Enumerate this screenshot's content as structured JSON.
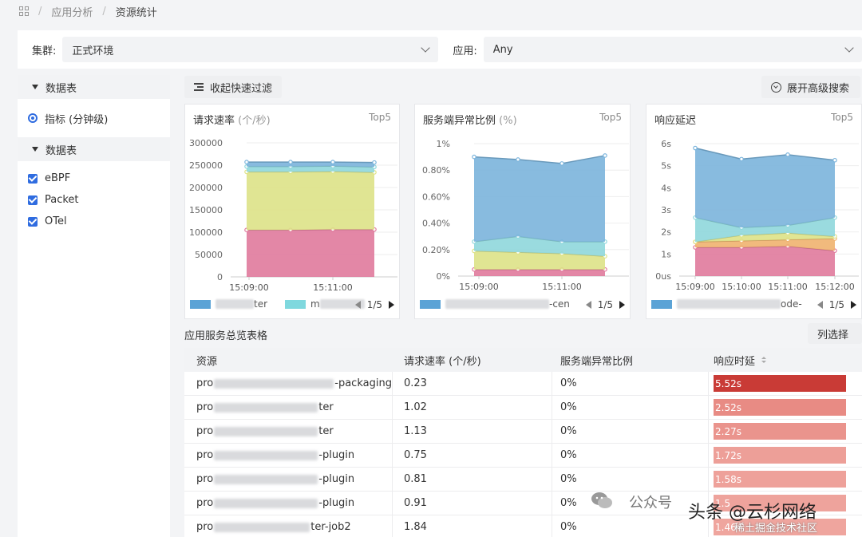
{
  "breadcrumb": {
    "items": [
      "应用分析",
      "资源统计"
    ]
  },
  "filters": {
    "cluster_label": "集群:",
    "cluster_value": "正式环境",
    "app_label": "应用:",
    "app_value": "Any"
  },
  "sidebar": {
    "section1_title": "数据表",
    "metric_option": "指标 (分钟级)",
    "section2_title": "数据表",
    "sources": [
      "eBPF",
      "Packet",
      "OTel"
    ]
  },
  "actions": {
    "collapse_filter": "收起快速过滤",
    "expand_advanced": "展开高级搜索",
    "column_select": "列选择"
  },
  "chart_data": [
    {
      "type": "area",
      "title": "请求速率",
      "unit": "(个/秒)",
      "badge": "Top5",
      "y_ticks": [
        "300000",
        "250000",
        "200000",
        "150000",
        "100000",
        "50000",
        "0"
      ],
      "ylim": [
        0,
        300000
      ],
      "x_ticks": [
        "15:09:00",
        "15:11:00"
      ],
      "series": [
        {
          "values": [
            105000,
            105000,
            106000,
            106000
          ],
          "color": "#e07a9c"
        },
        {
          "values": [
            130000,
            130000,
            130000,
            128000
          ],
          "color": "#dde287"
        },
        {
          "values": [
            12000,
            12000,
            12000,
            12000
          ],
          "color": "#8fd7dc"
        },
        {
          "values": [
            10000,
            10000,
            9000,
            10000
          ],
          "color": "#7bb4dc"
        }
      ],
      "legend": [
        {
          "suffix": "ter",
          "color": "#5ba3d6"
        },
        {
          "suffix": "m",
          "color": "#7fd8de"
        }
      ],
      "page": "1/5"
    },
    {
      "type": "area",
      "title": "服务端异常比例",
      "unit": "(%)",
      "badge": "Top5",
      "y_ticks": [
        "1%",
        "0.80%",
        "0.60%",
        "0.40%",
        "0.20%",
        "0%"
      ],
      "ylim": [
        0,
        1
      ],
      "x_ticks": [
        "15:09:00",
        "15:11:00"
      ],
      "series": [
        {
          "values": [
            0.05,
            0.05,
            0.05,
            0.05
          ],
          "color": "#e07a9c"
        },
        {
          "values": [
            0.14,
            0.13,
            0.12,
            0.1
          ],
          "color": "#dde287"
        },
        {
          "values": [
            0.07,
            0.12,
            0.09,
            0.11
          ],
          "color": "#8fd7dc"
        },
        {
          "values": [
            0.64,
            0.58,
            0.59,
            0.65
          ],
          "color": "#7bb4dc"
        }
      ],
      "legend": [
        {
          "suffix": "-cen",
          "color": "#5ba3d6"
        }
      ],
      "page": "1/5"
    },
    {
      "type": "area",
      "title": "响应延迟",
      "unit": "",
      "badge": "Top5",
      "y_ticks": [
        "6s",
        "5s",
        "4s",
        "3s",
        "2s",
        "1s",
        "0us"
      ],
      "ylim": [
        0,
        6
      ],
      "x_ticks": [
        "15:09:00",
        "15:10:00",
        "15:11:00",
        "15:12:00"
      ],
      "series": [
        {
          "values": [
            1.3,
            1.3,
            1.35,
            1.15
          ],
          "color": "#e07a9c"
        },
        {
          "values": [
            0.25,
            0.3,
            0.3,
            0.55
          ],
          "color": "#f0b26f"
        },
        {
          "values": [
            0.0,
            0.25,
            0.3,
            0.1
          ],
          "color": "#dde287"
        },
        {
          "values": [
            1.1,
            0.35,
            0.35,
            0.85
          ],
          "color": "#8fd7dc"
        },
        {
          "values": [
            3.15,
            3.1,
            3.2,
            2.6
          ],
          "color": "#7bb4dc"
        }
      ],
      "legend": [
        {
          "suffix": "ode-",
          "color": "#5ba3d6"
        }
      ],
      "page": "1/5"
    }
  ],
  "table": {
    "title": "应用服务总览表格",
    "headers": [
      "资源",
      "请求速率 (个/秒)",
      "服务端异常比例",
      "响应时延"
    ],
    "rows": [
      {
        "prefix": "pro",
        "suffix": "-packaging",
        "rate": "0.23",
        "err": "0%",
        "latency": "5.52s",
        "color": "#c93b36"
      },
      {
        "prefix": "pro",
        "suffix": "ter",
        "rate": "1.02",
        "err": "0%",
        "latency": "2.52s",
        "color": "#e88b84"
      },
      {
        "prefix": "pro",
        "suffix": "ter",
        "rate": "1.13",
        "err": "0%",
        "latency": "2.27s",
        "color": "#ea948d"
      },
      {
        "prefix": "pro",
        "suffix": "-plugin",
        "rate": "0.75",
        "err": "0%",
        "latency": "1.72s",
        "color": "#ed9f98"
      },
      {
        "prefix": "pro",
        "suffix": "-plugin",
        "rate": "0.81",
        "err": "0%",
        "latency": "1.58s",
        "color": "#eea19a"
      },
      {
        "prefix": "pro",
        "suffix": "-plugin",
        "rate": "0.91",
        "err": "0%",
        "latency": "1.5",
        "color": "#eea39c"
      },
      {
        "prefix": "pro",
        "suffix": "ter-job2",
        "rate": "1.84",
        "err": "0%",
        "latency": "1.46",
        "color": "#efa59e"
      }
    ]
  },
  "watermark": {
    "platform": "公众号",
    "text": "头条 @云杉网络",
    "subtext": "稀土掘金技术社区"
  }
}
